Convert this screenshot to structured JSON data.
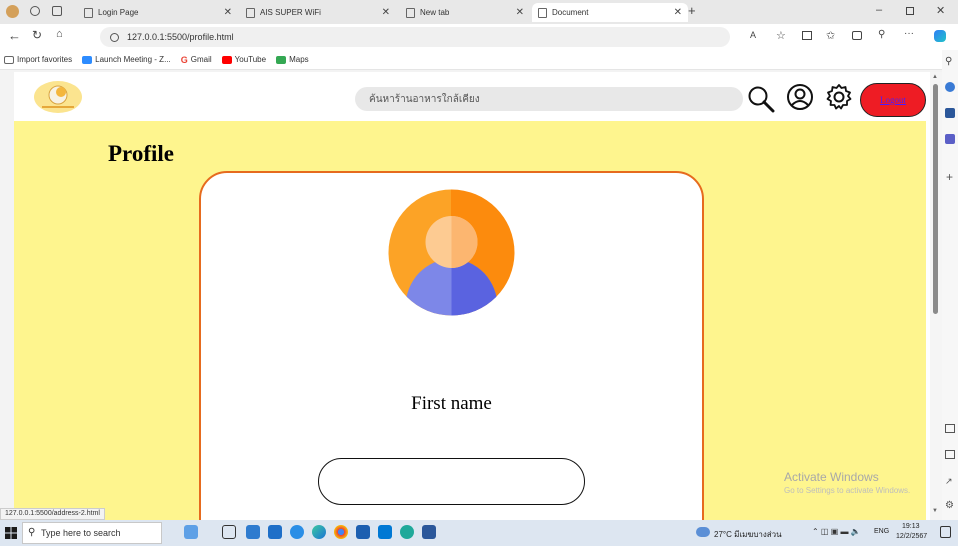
{
  "browser": {
    "tabs": [
      {
        "label": "Login Page"
      },
      {
        "label": "AIS SUPER WiFi"
      },
      {
        "label": "New tab"
      },
      {
        "label": "Document"
      }
    ],
    "url": "127.0.0.1:5500/profile.html",
    "favorites": [
      {
        "label": "Import favorites",
        "color": "#666666"
      },
      {
        "label": "Launch Meeting - Z...",
        "color": "#2d8cff"
      },
      {
        "label": "Gmail",
        "color": "#ea4335"
      },
      {
        "label": "YouTube",
        "color": "#ff0000"
      },
      {
        "label": "Maps",
        "color": "#34a853"
      }
    ],
    "status_url": "127.0.0.1:5500/address-2.html"
  },
  "header": {
    "search_placeholder": "ค้นหาร้านอาหารใกล้เคียง",
    "logout_label": "Logout",
    "icons": [
      "search-icon",
      "user-icon",
      "settings-icon"
    ]
  },
  "profile": {
    "title": "Profile",
    "first_name_label": "First name",
    "first_name_value": ""
  },
  "watermark": {
    "line1": "Activate Windows",
    "line2": "Go to Settings to activate Windows."
  },
  "taskbar": {
    "search_placeholder": "Type here to search",
    "weather": "27°C มีเมฆบางส่วน",
    "lang": "ENG",
    "time": "19:13",
    "date": "12/2/2567"
  },
  "colors": {
    "page_bg": "#fef58e",
    "card_border": "#e66b1e",
    "logout_bg": "#ee1c24"
  }
}
